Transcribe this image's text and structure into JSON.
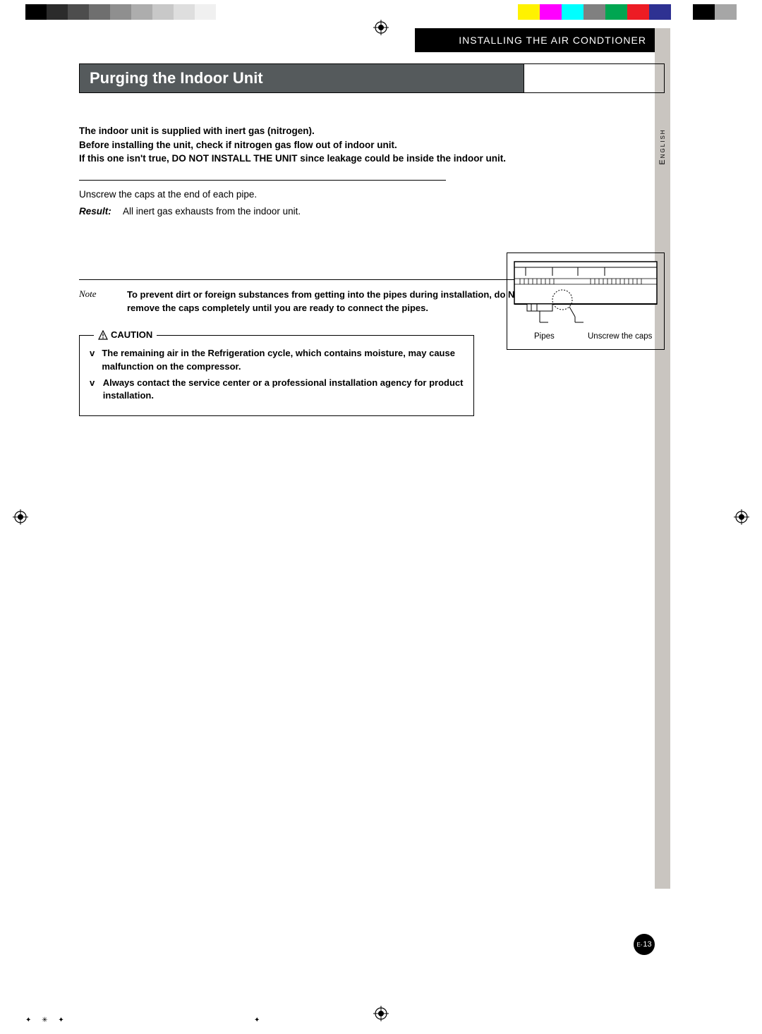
{
  "chapter": "Installing the Air Condtioner",
  "language_tab": "English",
  "title": "Purging the Indoor Unit",
  "intro_lines": [
    "The indoor unit is supplied with inert gas (nitrogen).",
    "Before installing the unit, check if nitrogen gas flow out of indoor unit.",
    "If this one isn't true, DO NOT INSTALL THE UNIT since leakage could be inside the indoor unit."
  ],
  "step_text": "Unscrew the caps at the end of each pipe.",
  "result_label": "Result:",
  "result_text": "All inert gas exhausts from the indoor unit.",
  "note_label": "Note",
  "note_text": "To prevent dirt or foreign substances from getting into the pipes during installation, do NOT remove the caps completely until you are ready to connect the pipes.",
  "caution_label": "CAUTION",
  "caution_items": [
    "The remaining air in the Refrigeration cycle, which contains moisture, may cause malfunction on the compressor.",
    "Always contact the service center or a professional installation agency for product installation."
  ],
  "figure": {
    "label_pipes": "Pipes",
    "label_caps": "Unscrew the caps"
  },
  "page_number_prefix": "E-",
  "page_number": "13",
  "colorbar": {
    "grays": [
      "#000000",
      "#2b2b2b",
      "#4d4d4d",
      "#6f6f6f",
      "#8f8f8f",
      "#adadad",
      "#c8c8c8",
      "#dedede",
      "#f0f0f0",
      "#ffffff"
    ],
    "colors": [
      "#fff200",
      "#ff00ff",
      "#00ffff",
      "#808080",
      "#00a651",
      "#ed1c24",
      "#2e3192",
      "#ffffff",
      "#000000",
      "#a6a6a6"
    ]
  }
}
